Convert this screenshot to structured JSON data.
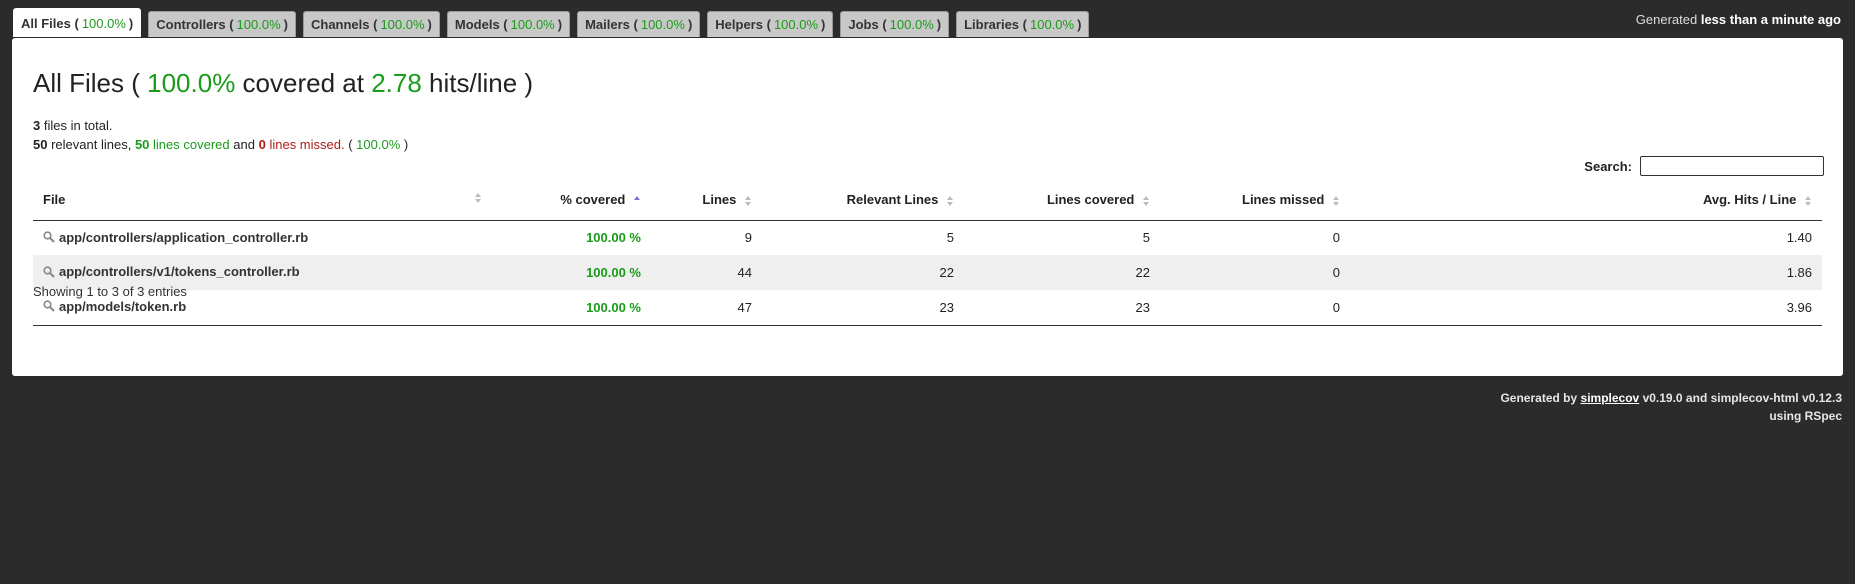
{
  "tabs": [
    {
      "label": "All Files",
      "pct": "100.0%"
    },
    {
      "label": "Controllers",
      "pct": "100.0%"
    },
    {
      "label": "Channels",
      "pct": "100.0%"
    },
    {
      "label": "Models",
      "pct": "100.0%"
    },
    {
      "label": "Mailers",
      "pct": "100.0%"
    },
    {
      "label": "Helpers",
      "pct": "100.0%"
    },
    {
      "label": "Jobs",
      "pct": "100.0%"
    },
    {
      "label": "Libraries",
      "pct": "100.0%"
    }
  ],
  "generated": {
    "prefix": "Generated",
    "when": "less than a minute ago"
  },
  "title": {
    "name": "All Files",
    "pct": "100.0%",
    "covered_at": "covered at",
    "hits": "2.78",
    "unit": "hits/line"
  },
  "summary": {
    "files_total": "3",
    "files_text": "files in total.",
    "relevant": "50",
    "relevant_text": "relevant lines,",
    "covered": "50",
    "covered_text": "lines covered",
    "and": "and",
    "missed": "0",
    "missed_text": "lines missed.",
    "pct": "100.0%"
  },
  "search": {
    "label": "Search:",
    "placeholder": ""
  },
  "table": {
    "headers": [
      "File",
      "% covered",
      "Lines",
      "Relevant Lines",
      "Lines covered",
      "Lines missed",
      "Avg. Hits / Line"
    ],
    "rows": [
      {
        "file": "app/controllers/application_controller.rb",
        "covered": "100.00 %",
        "lines": "9",
        "relevant": "5",
        "lines_covered": "5",
        "missed": "0",
        "avg": "1.40"
      },
      {
        "file": "app/controllers/v1/tokens_controller.rb",
        "covered": "100.00 %",
        "lines": "44",
        "relevant": "22",
        "lines_covered": "22",
        "missed": "0",
        "avg": "1.86"
      },
      {
        "file": "app/models/token.rb",
        "covered": "100.00 %",
        "lines": "47",
        "relevant": "23",
        "lines_covered": "23",
        "missed": "0",
        "avg": "3.96"
      }
    ]
  },
  "entries_info": "Showing 1 to 3 of 3 entries",
  "footer": {
    "prefix": "Generated by",
    "link": "simplecov",
    "rest": "v0.19.0 and simplecov-html v0.12.3",
    "line2": "using RSpec"
  },
  "colors": {
    "covered": "#1a9b1a",
    "missed": "#b01c1c",
    "background": "#2b2b2b"
  }
}
